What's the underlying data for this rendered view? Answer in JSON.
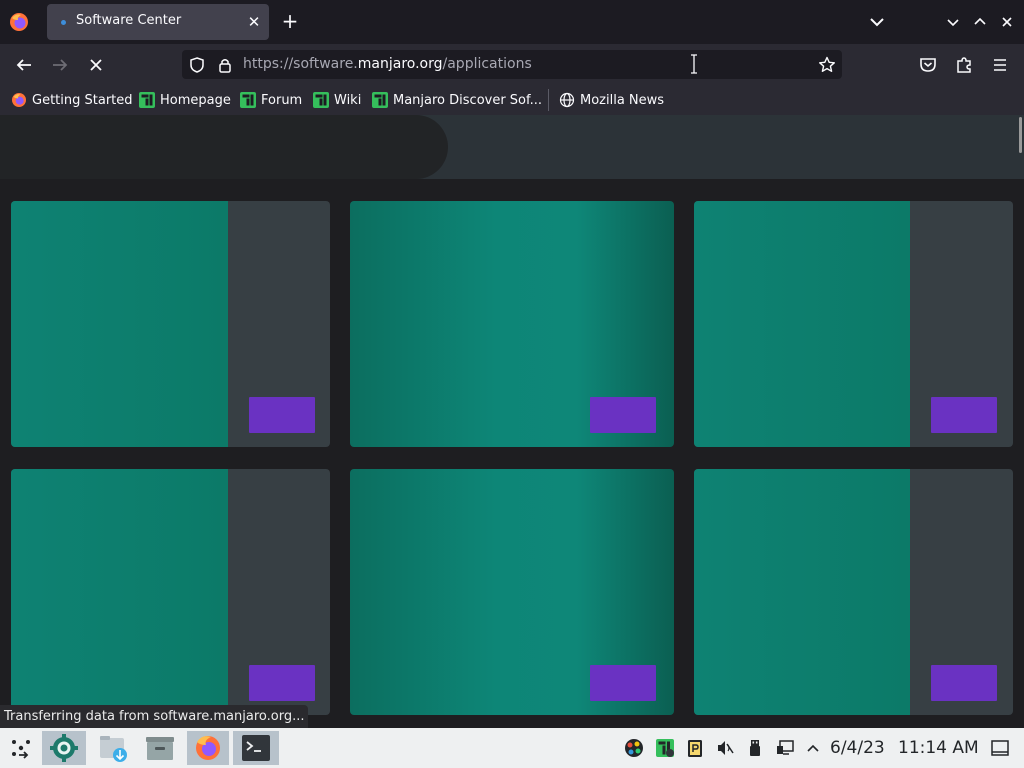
{
  "browser": {
    "tab": {
      "title": "Software Center",
      "close_label": "✕"
    },
    "new_tab_label": "+",
    "url": {
      "prefix": "https://software.",
      "domain": "manjaro.org",
      "path": "/applications"
    },
    "bookmarks": [
      {
        "label": "Getting Started",
        "icon": "firefox-icon"
      },
      {
        "label": "Homepage",
        "icon": "manjaro-icon"
      },
      {
        "label": "Forum",
        "icon": "manjaro-icon"
      },
      {
        "label": "Wiki",
        "icon": "manjaro-icon"
      },
      {
        "label": "Manjaro Discover Sof...",
        "icon": "manjaro-icon"
      },
      {
        "label": "Mozilla News",
        "icon": "globe-icon"
      }
    ],
    "status_text": "Transferring data from software.manjaro.org..."
  },
  "page": {
    "cards": [
      {
        "style": "split"
      },
      {
        "style": "full"
      },
      {
        "style": "split"
      },
      {
        "style": "split"
      },
      {
        "style": "full"
      },
      {
        "style": "split"
      }
    ]
  },
  "taskbar": {
    "apps": [
      "application-launcher-icon",
      "settings-icon",
      "downloads-icon",
      "file-manager-icon",
      "firefox-icon",
      "terminal-icon"
    ],
    "tray": [
      "color-picker-icon",
      "manjaro-settings-icon",
      "clipboard-icon",
      "volume-muted-icon",
      "usb-icon",
      "network-icon",
      "expand-tray-icon"
    ],
    "date": "6/4/23",
    "time": "11:14 AM"
  },
  "colors": {
    "card_green": "#0d8677",
    "card_side": "#373f44",
    "card_button": "#6a32c2",
    "manjaro_green": "#35bf5c"
  }
}
